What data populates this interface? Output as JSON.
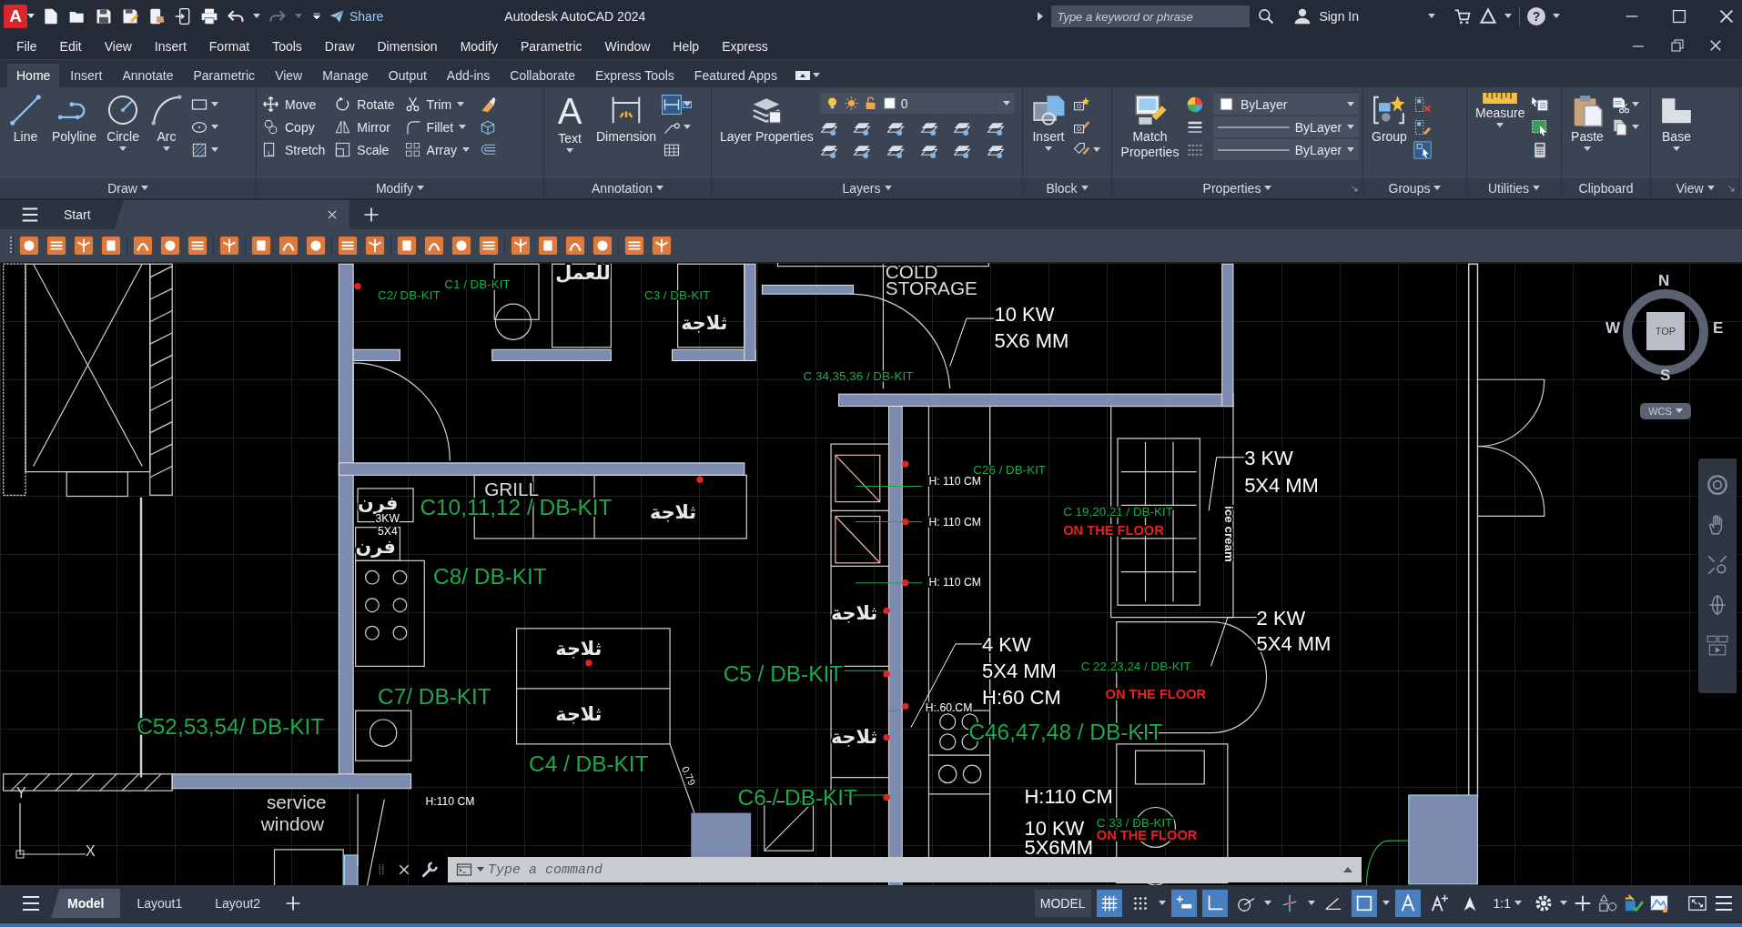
{
  "title_bar": {
    "logo": "A",
    "share": "Share",
    "title": "Autodesk AutoCAD 2024",
    "search": {
      "placeholder": "Type a keyword or phrase"
    },
    "sign_in": "Sign In",
    "help": "?"
  },
  "menu_bar": [
    "File",
    "Edit",
    "View",
    "Insert",
    "Format",
    "Tools",
    "Draw",
    "Dimension",
    "Modify",
    "Parametric",
    "Window",
    "Help",
    "Express"
  ],
  "ribbon_tabs": [
    {
      "label": "Home",
      "selected": true
    },
    {
      "label": "Insert",
      "selected": false
    },
    {
      "label": "Annotate",
      "selected": false
    },
    {
      "label": "Parametric",
      "selected": false
    },
    {
      "label": "View",
      "selected": false
    },
    {
      "label": "Manage",
      "selected": false
    },
    {
      "label": "Output",
      "selected": false
    },
    {
      "label": "Add-ins",
      "selected": false
    },
    {
      "label": "Collaborate",
      "selected": false
    },
    {
      "label": "Express Tools",
      "selected": false
    },
    {
      "label": "Featured Apps",
      "selected": false
    }
  ],
  "ribbon_panels": [
    {
      "title": "Draw",
      "items": [
        {
          "kind": "large",
          "label": "Line"
        },
        {
          "kind": "large",
          "label": "Polyline"
        },
        {
          "kind": "large",
          "label": "Circle"
        },
        {
          "kind": "large",
          "label": "Arc"
        },
        {
          "kind": "icon"
        },
        {
          "kind": "icon"
        },
        {
          "kind": "icon"
        }
      ]
    },
    {
      "title": "Modify",
      "items": [
        {
          "kind": "small",
          "label": "Move"
        },
        {
          "kind": "small",
          "label": "Copy"
        },
        {
          "kind": "small",
          "label": "Stretch"
        },
        {
          "kind": "small",
          "label": "Rotate"
        },
        {
          "kind": "small",
          "label": "Mirror"
        },
        {
          "kind": "small",
          "label": "Scale"
        },
        {
          "kind": "small",
          "label": "Trim"
        },
        {
          "kind": "small",
          "label": "Fillet"
        },
        {
          "kind": "small",
          "label": "Array"
        },
        {
          "kind": "icon"
        },
        {
          "kind": "icon"
        },
        {
          "kind": "icon"
        }
      ]
    },
    {
      "title": "Annotation",
      "items": [
        {
          "kind": "large",
          "label": "Text",
          "glyph": "A"
        },
        {
          "kind": "large",
          "label": "Dimension"
        },
        {
          "kind": "icon"
        },
        {
          "kind": "icon"
        },
        {
          "kind": "icon"
        }
      ]
    },
    {
      "title": "Layers",
      "items": [
        {
          "kind": "large",
          "label": "Layer Properties"
        },
        {
          "kind": "layer_combo",
          "value": "0"
        },
        {
          "kind": "icon"
        },
        {
          "kind": "icon"
        },
        {
          "kind": "icon"
        },
        {
          "kind": "icon"
        },
        {
          "kind": "icon"
        },
        {
          "kind": "icon"
        },
        {
          "kind": "icon"
        },
        {
          "kind": "icon"
        },
        {
          "kind": "icon"
        },
        {
          "kind": "icon"
        },
        {
          "kind": "icon"
        },
        {
          "kind": "icon"
        }
      ]
    },
    {
      "title": "Block",
      "items": [
        {
          "kind": "large",
          "label": "Insert"
        },
        {
          "kind": "icon"
        },
        {
          "kind": "icon"
        },
        {
          "kind": "icon"
        }
      ]
    },
    {
      "title": "Properties",
      "items": [
        {
          "kind": "large",
          "label": "Match Properties"
        },
        {
          "kind": "icon"
        },
        {
          "kind": "icon"
        },
        {
          "kind": "icon"
        },
        {
          "kind": "swatch_combo",
          "value": "ByLayer"
        },
        {
          "kind": "line_combo",
          "value": "ByLayer"
        },
        {
          "kind": "line_combo",
          "value": "ByLayer"
        }
      ]
    },
    {
      "title": "Groups",
      "items": [
        {
          "kind": "large",
          "label": "Group"
        },
        {
          "kind": "icon"
        },
        {
          "kind": "icon"
        },
        {
          "kind": "icon"
        }
      ]
    },
    {
      "title": "Utilities",
      "items": [
        {
          "kind": "large",
          "label": "Measure"
        },
        {
          "kind": "icon"
        },
        {
          "kind": "icon"
        },
        {
          "kind": "icon"
        }
      ]
    },
    {
      "title": "Clipboard",
      "items": [
        {
          "kind": "large",
          "label": "Paste"
        },
        {
          "kind": "icon"
        },
        {
          "kind": "icon"
        }
      ]
    },
    {
      "title": "View",
      "items": [
        {
          "kind": "large",
          "label": "Base"
        }
      ]
    }
  ],
  "doc_tabs": [
    {
      "label": "Start",
      "selected": false
    },
    {
      "selected": true
    }
  ],
  "drawing": {
    "labels": [
      {
        "text": "COLD",
        "kind": "room"
      },
      {
        "text": "STORAGE",
        "kind": "room"
      },
      {
        "text": "10 KW",
        "kind": "note"
      },
      {
        "text": "5X6 MM",
        "kind": "note"
      },
      {
        "text": "C 34,35,36 / DB-KIT",
        "kind": "circuit_small"
      },
      {
        "text": "C2/ DB-KIT",
        "kind": "circuit_small"
      },
      {
        "text": "C1 / DB-KIT",
        "kind": "circuit_small"
      },
      {
        "text": "C3 / DB-KIT",
        "kind": "circuit_small"
      },
      {
        "text": "للعمل",
        "kind": "arabic"
      },
      {
        "text": "ثلاجة",
        "kind": "arabic"
      },
      {
        "text": "فرن",
        "kind": "arabic"
      },
      {
        "text": "3KW",
        "kind": "note_small"
      },
      {
        "text": "5X4",
        "kind": "note_small"
      },
      {
        "text": "فرن",
        "kind": "arabic"
      },
      {
        "text": "GRILL",
        "kind": "room"
      },
      {
        "text": "C10,11,12 / DB-KIT",
        "kind": "circuit"
      },
      {
        "text": "ثلاجة",
        "kind": "arabic"
      },
      {
        "text": "C8/ DB-KIT",
        "kind": "circuit"
      },
      {
        "text": "C26 / DB-KIT",
        "kind": "circuit_small"
      },
      {
        "text": "H: 110 CM",
        "kind": "note_small"
      },
      {
        "text": "H: 110 CM",
        "kind": "note_small"
      },
      {
        "text": "H: 110 CM",
        "kind": "note_small"
      },
      {
        "text": "3 KW",
        "kind": "note"
      },
      {
        "text": "5X4 MM",
        "kind": "note"
      },
      {
        "text": "C 19,20,21 / DB-KIT",
        "kind": "circuit_small"
      },
      {
        "text": "ON THE FLOOR",
        "kind": "warning"
      },
      {
        "text": "ice cream",
        "kind": "vertical"
      },
      {
        "text": "2 KW",
        "kind": "note"
      },
      {
        "text": "5X4 MM",
        "kind": "note"
      },
      {
        "text": "ثلاجة",
        "kind": "arabic"
      },
      {
        "text": "ثلاجة",
        "kind": "arabic"
      },
      {
        "text": "C 22,23,24 / DB-KIT",
        "kind": "circuit_small"
      },
      {
        "text": "ON THE FLOOR",
        "kind": "warning"
      },
      {
        "text": "4 KW",
        "kind": "note"
      },
      {
        "text": "5X4 MM",
        "kind": "note"
      },
      {
        "text": "H:60 CM",
        "kind": "note"
      },
      {
        "text": "C5 /  DB-KIT",
        "kind": "circuit"
      },
      {
        "text": "H: 60 CM",
        "kind": "note_small"
      },
      {
        "text": "C46,47,48  / DB-KIT",
        "kind": "circuit"
      },
      {
        "text": "C7/ DB-KIT",
        "kind": "circuit"
      },
      {
        "text": "C52,53,54/ DB-KIT",
        "kind": "circuit"
      },
      {
        "text": "ثلاجة",
        "kind": "arabic"
      },
      {
        "text": "ثلاجة",
        "kind": "arabic"
      },
      {
        "text": "C4 / DB-KIT",
        "kind": "circuit"
      },
      {
        "text": "0.79",
        "kind": "dimension"
      },
      {
        "text": "H:110 CM",
        "kind": "note_small"
      },
      {
        "text": "C6 / DB-KIT",
        "kind": "circuit"
      },
      {
        "text": "H:110 CM",
        "kind": "note"
      },
      {
        "text": "service",
        "kind": "room"
      },
      {
        "text": "window",
        "kind": "room"
      },
      {
        "text": "C 33 / DB-KIT",
        "kind": "circuit_small"
      },
      {
        "text": "ON THE FLOOR",
        "kind": "warning"
      },
      {
        "text": "10 KW",
        "kind": "note"
      },
      {
        "text": "5X6MM",
        "kind": "note"
      }
    ]
  },
  "view_cube": {
    "north": "N",
    "south": "S",
    "east": "E",
    "west": "W",
    "face": "TOP",
    "ucs_menu": "WCS"
  },
  "ucs": {
    "y_axis": "Y",
    "x_axis": "X"
  },
  "command_line": {
    "placeholder": "Type a command"
  },
  "layout_tabs": [
    {
      "label": "Model",
      "selected": true
    },
    {
      "label": "Layout1",
      "selected": false
    },
    {
      "label": "Layout2",
      "selected": false
    }
  ],
  "status_bar": {
    "model_button": "MODEL",
    "annotation_scale": "1:1"
  },
  "status_toggles": [
    {
      "on": true
    },
    {
      "on": false
    },
    {
      "on": true
    },
    {
      "on": true
    },
    {
      "on": false
    },
    {
      "on": false
    },
    {
      "on": false
    },
    {
      "on": true
    },
    {
      "on": true
    },
    {
      "on": false
    },
    {
      "on": false
    }
  ]
}
